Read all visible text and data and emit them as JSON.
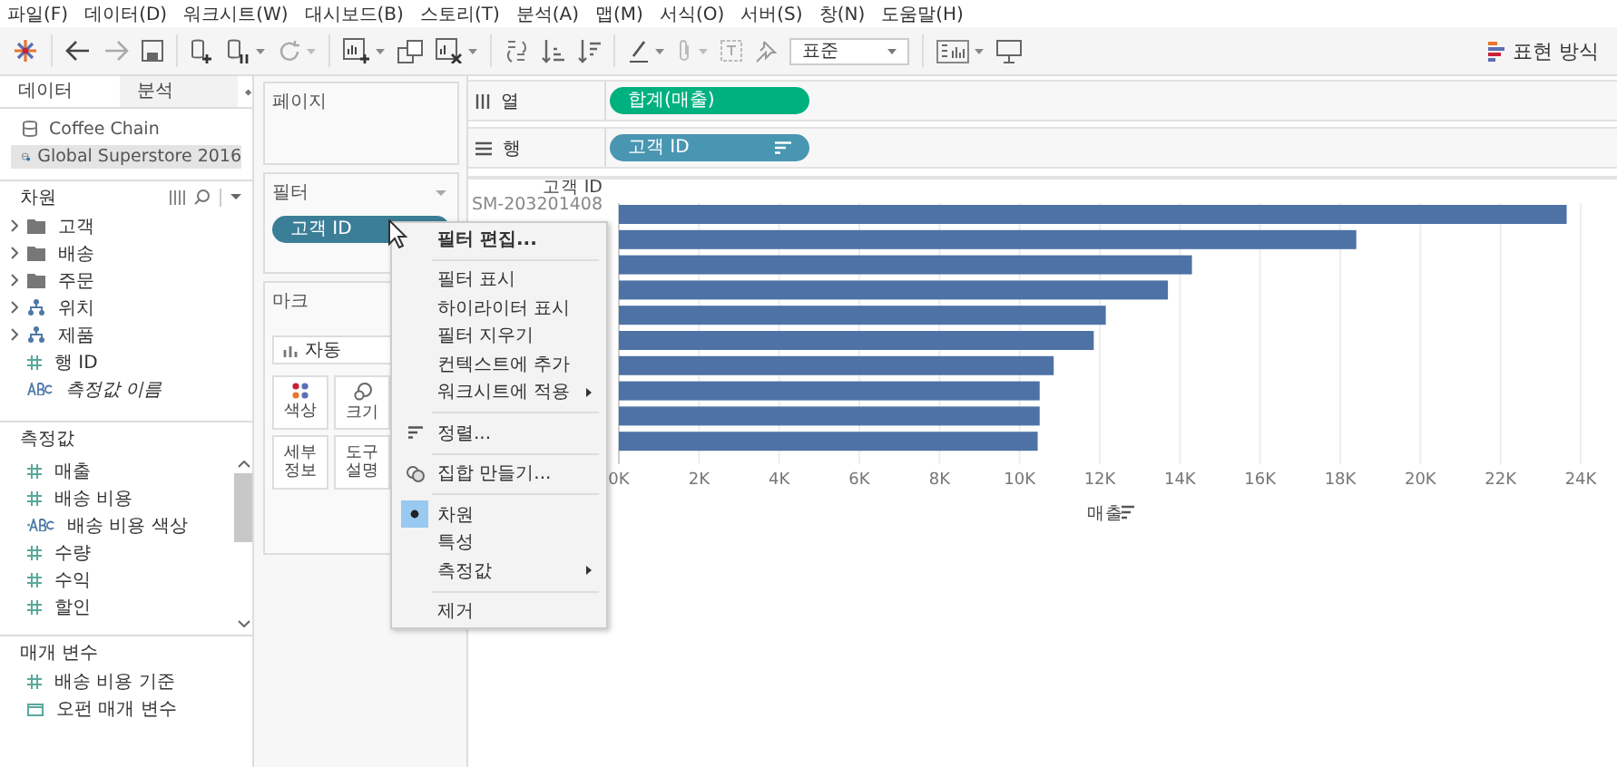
{
  "menu_bar": [
    "파일(F)",
    "데이터(D)",
    "워크시트(W)",
    "대시보드(B)",
    "스토리(T)",
    "분석(A)",
    "맵(M)",
    "서식(O)",
    "서버(S)",
    "창(N)",
    "도움말(H)"
  ],
  "toolbar": {
    "fit_select": "표준",
    "show_me": "표현 방식"
  },
  "data_pane": {
    "tabs": [
      {
        "label": "데이터",
        "selected": true
      },
      {
        "label": "분석",
        "selected": false
      }
    ],
    "sources": [
      {
        "name": "Coffee Chain",
        "selected": false
      },
      {
        "name": "Global Superstore 2016",
        "selected": true
      }
    ],
    "dimensions": {
      "title": "차원",
      "items": [
        {
          "kind": "folder",
          "label": "고객"
        },
        {
          "kind": "folder",
          "label": "배송"
        },
        {
          "kind": "folder",
          "label": "주문"
        },
        {
          "kind": "hierarchy",
          "label": "위치"
        },
        {
          "kind": "hierarchy",
          "label": "제품"
        },
        {
          "kind": "number",
          "label": "행 ID"
        },
        {
          "kind": "text",
          "label": "측정값 이름",
          "italic": true
        }
      ]
    },
    "measures": {
      "title": "측정값",
      "items": [
        {
          "kind": "number",
          "label": "매출"
        },
        {
          "kind": "number",
          "label": "배송 비용"
        },
        {
          "kind": "calc-text",
          "label": "배송 비용 색상"
        },
        {
          "kind": "number",
          "label": "수량"
        },
        {
          "kind": "number",
          "label": "수익"
        },
        {
          "kind": "number",
          "label": "할인"
        }
      ]
    },
    "parameters": {
      "title": "매개 변수",
      "items": [
        {
          "kind": "number",
          "label": "배송 비용 기준"
        },
        {
          "kind": "date",
          "label": "오펀 매개 변수"
        }
      ]
    }
  },
  "pages_card": {
    "title": "페이지"
  },
  "filters_card": {
    "title": "필터",
    "pills": [
      "고객 ID"
    ]
  },
  "marks_card": {
    "title": "마크",
    "mark_type": "자동",
    "buttons": [
      {
        "kind": "color",
        "label": "색상"
      },
      {
        "kind": "size",
        "label": "크기"
      },
      {
        "kind": "plain",
        "label": "세부\n정보"
      },
      {
        "kind": "plain",
        "label": "도구\n설명"
      }
    ]
  },
  "columns_shelf": {
    "label": "열",
    "pill": "합계(매출)"
  },
  "rows_shelf": {
    "label": "행",
    "pill": "고객 ID"
  },
  "view": {
    "row_header": "고객 ID",
    "first_row_label": "SM-203201408",
    "chart_data": {
      "type": "bar",
      "orientation": "horizontal",
      "xlabel": "매출",
      "values": [
        23650,
        18400,
        14300,
        13700,
        12150,
        11850,
        10850,
        10500,
        10500,
        10450
      ],
      "xlim": [
        0,
        24000
      ],
      "grid": true,
      "xticks": [
        {
          "value": 0,
          "label": "0K"
        },
        {
          "value": 2000,
          "label": "2K"
        },
        {
          "value": 4000,
          "label": "4K"
        },
        {
          "value": 6000,
          "label": "6K"
        },
        {
          "value": 8000,
          "label": "8K"
        },
        {
          "value": 10000,
          "label": "10K"
        },
        {
          "value": 12000,
          "label": "12K"
        },
        {
          "value": 14000,
          "label": "14K"
        },
        {
          "value": 16000,
          "label": "16K"
        },
        {
          "value": 18000,
          "label": "18K"
        },
        {
          "value": 20000,
          "label": "20K"
        },
        {
          "value": 22000,
          "label": "22K"
        },
        {
          "value": 24000,
          "label": "24K"
        }
      ]
    }
  },
  "context_menu": {
    "items": [
      {
        "kind": "item",
        "label": "필터 편집...",
        "bold": true
      },
      {
        "kind": "separator"
      },
      {
        "kind": "item",
        "label": "필터 표시"
      },
      {
        "kind": "item",
        "label": "하이라이터 표시"
      },
      {
        "kind": "item",
        "label": "필터 지우기"
      },
      {
        "kind": "item",
        "label": "컨텍스트에 추가"
      },
      {
        "kind": "item",
        "label": "워크시트에 적용",
        "submenu": true
      },
      {
        "kind": "separator"
      },
      {
        "kind": "sort-item",
        "label": "정렬..."
      },
      {
        "kind": "separator"
      },
      {
        "kind": "set-item",
        "label": "집합 만들기..."
      },
      {
        "kind": "separator"
      },
      {
        "kind": "radio",
        "label": "차원",
        "checked": true
      },
      {
        "kind": "radio",
        "label": "특성",
        "checked": false
      },
      {
        "kind": "item",
        "label": "측정값",
        "submenu": true
      },
      {
        "kind": "separator"
      },
      {
        "kind": "item",
        "label": "제거"
      }
    ]
  }
}
